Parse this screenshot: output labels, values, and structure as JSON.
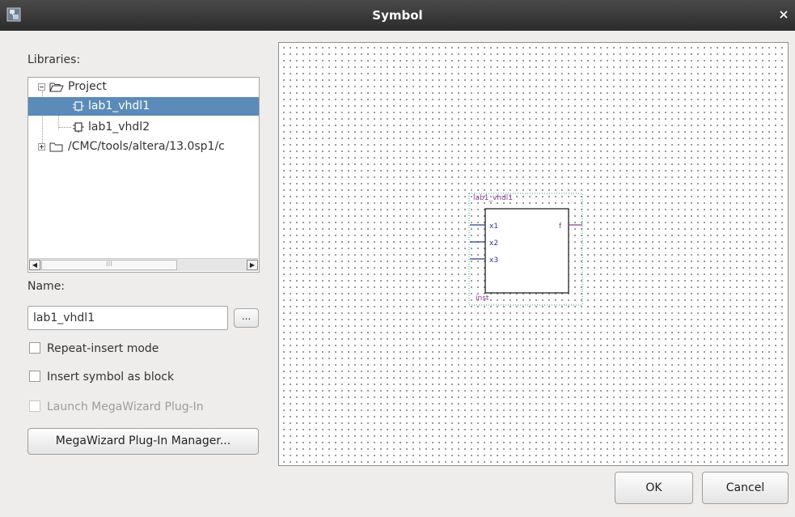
{
  "window": {
    "title": "Symbol"
  },
  "libraries": {
    "label": "Libraries:",
    "tree": [
      {
        "label": "Project",
        "icon": "folder-open-icon",
        "expanded": true
      },
      {
        "label": "lab1_vhdl1",
        "icon": "symbol-icon",
        "selected": true
      },
      {
        "label": "lab1_vhdl2",
        "icon": "symbol-icon"
      },
      {
        "label": "/CMC/tools/altera/13.0sp1/c",
        "icon": "folder-closed-icon",
        "expanded": false
      }
    ],
    "scrollbar_thumb": "III"
  },
  "name": {
    "label": "Name:",
    "value": "lab1_vhdl1",
    "browse_label": "..."
  },
  "options": {
    "repeat_insert": "Repeat-insert mode",
    "insert_as_block": "Insert symbol as block",
    "launch_megawizard": "Launch MegaWizard Plug-In"
  },
  "megawizard_button": "MegaWizard Plug-In Manager...",
  "preview": {
    "symbol_name": "lab1_vhdl1",
    "instance": "inst",
    "inputs": [
      "x1",
      "x2",
      "x3"
    ],
    "outputs": [
      "f"
    ]
  },
  "footer": {
    "ok_label": "OK",
    "cancel_label": "Cancel"
  }
}
